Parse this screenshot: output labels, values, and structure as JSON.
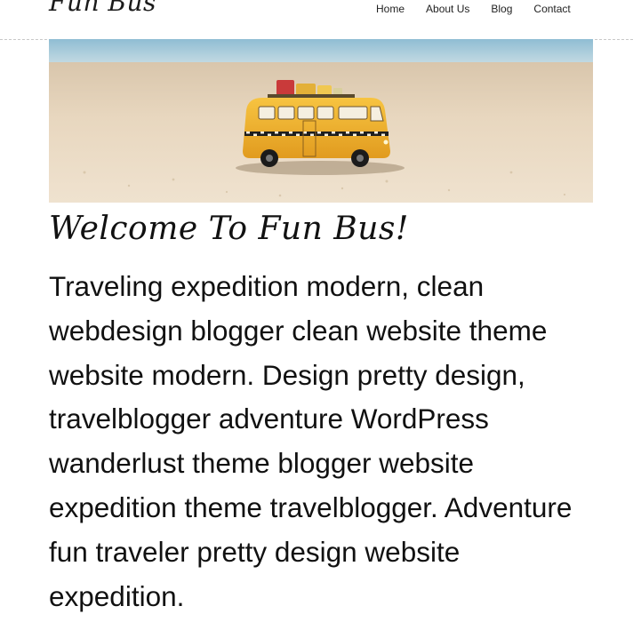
{
  "site": {
    "title": "Fun Bus"
  },
  "nav": {
    "items": [
      {
        "label": "Home"
      },
      {
        "label": "About Us"
      },
      {
        "label": "Blog"
      },
      {
        "label": "Contact"
      }
    ]
  },
  "hero": {
    "image_subject": "toy-yellow-bus-on-beach"
  },
  "main": {
    "heading": "Welcome To Fun Bus!",
    "paragraph": "Traveling expedition modern, clean webdesign blogger clean website theme website modern. Design pretty design, travelblogger adventure WordPress wanderlust theme blogger website expedition theme travelblogger. Adventure fun traveler pretty design website expedition."
  },
  "colors": {
    "bus_yellow": "#f2b531",
    "sand": "#e7d6bd",
    "sky": "#9fc4d6"
  }
}
